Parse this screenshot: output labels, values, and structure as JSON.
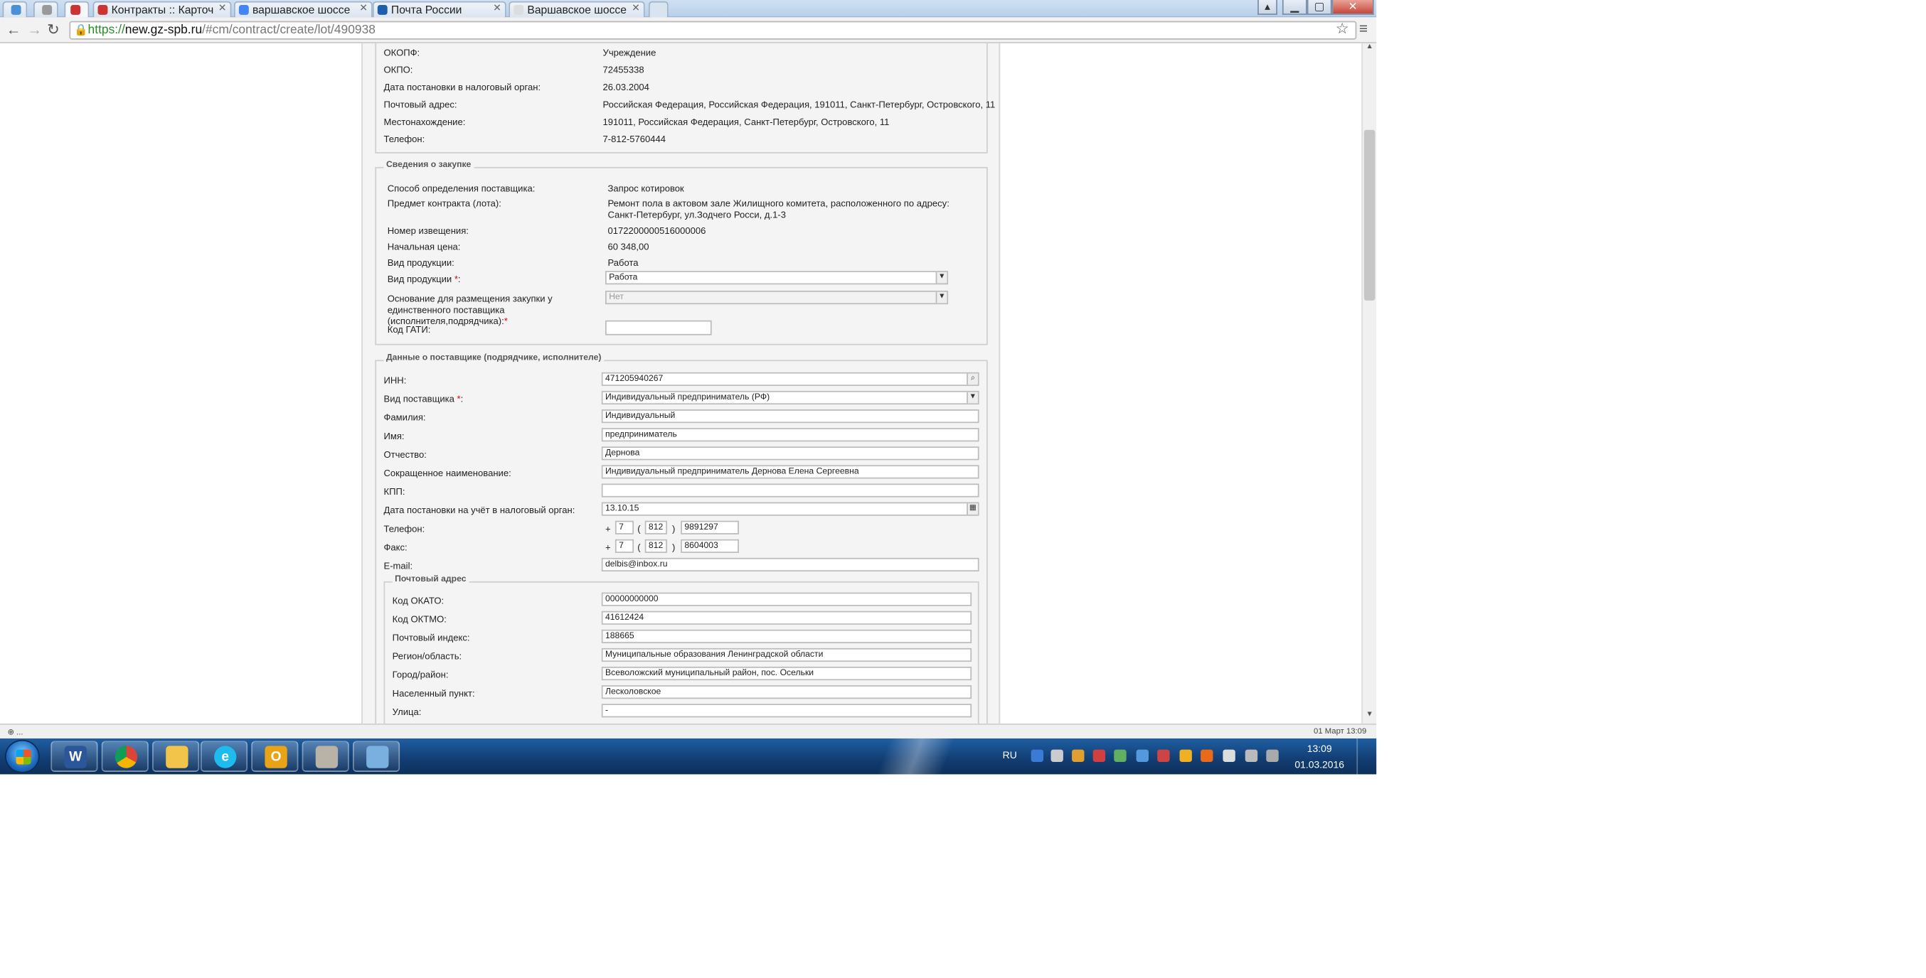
{
  "browser": {
    "tabs": [
      {
        "label": ""
      },
      {
        "label": ""
      },
      {
        "label": "Контракты :: Карточ"
      },
      {
        "label": "варшавское шоссе"
      },
      {
        "label": "Почта России"
      },
      {
        "label": "Варшавское шоссе"
      }
    ],
    "url_scheme": "https://",
    "url_host": "new.gz-spb.ru",
    "url_path": "/#cm/contract/create/lot/490938"
  },
  "customer": {
    "okopf_label": "ОКОПФ:",
    "okopf": "Учреждение",
    "okpo_label": "ОКПО:",
    "okpo": "72455338",
    "tax_date_label": "Дата постановки в налоговый орган:",
    "tax_date": "26.03.2004",
    "postal_label": "Почтовый адрес:",
    "postal": "Российская Федерация, Российская Федерация, 191011, Санкт-Петербург, Островского, 11",
    "location_label": "Местонахождение:",
    "location": "191011, Российская Федерация, Санкт-Петербург, Островского, 11",
    "phone_label": "Телефон:",
    "phone": "7-812-5760444"
  },
  "purchase": {
    "legend": "Сведения о закупке",
    "method_label": "Способ определения поставщика:",
    "method": "Запрос котировок",
    "subject_label": "Предмет контракта (лота):",
    "subject": "Ремонт пола в актовом зале Жилищного комитета, расположенного по адресу: Санкт-Петербург, ул.Зодчего Росси, д.1-3",
    "notice_label": "Номер извещения:",
    "notice": "0172200000516000006",
    "price_label": "Начальная цена:",
    "price": "60 348,00",
    "product_type_label": "Вид продукции:",
    "product_type": "Работа",
    "product_type_select_label": "Вид продукции",
    "product_type_select": "Работа",
    "single_basis_label": "Основание для размещения закупки у единственного поставщика (исполнителя,подрядчика):",
    "single_basis": "Нет",
    "gati_label": "Код ГАТИ:",
    "gati": ""
  },
  "supplier": {
    "legend": "Данные о поставщике (подрядчике, исполнителе)",
    "inn_label": "ИНН:",
    "inn": "471205940267",
    "type_label": "Вид поставщика",
    "type": "Индивидуальный предприниматель (РФ)",
    "last_name_label": "Фамилия:",
    "last_name": "Индивидуальный",
    "first_name_label": "Имя:",
    "first_name": "предприниматель",
    "patronymic_label": "Отчество:",
    "patronymic": "Дернова",
    "short_name_label": "Сокращенное наименование:",
    "short_name": "Индивидуальный предприниматель Дернова Елена Сергеевна",
    "kpp_label": "КПП:",
    "kpp": "",
    "tax_date_label": "Дата постановки на учёт в налоговый орган:",
    "tax_date": "13.10.15",
    "phone_label": "Телефон:",
    "phone_country": "7",
    "phone_code": "812",
    "phone_number": "9891297",
    "fax_label": "Факс:",
    "fax_country": "7",
    "fax_code": "812",
    "fax_number": "8604003",
    "email_label": "E-mail:",
    "email": "delbis@inbox.ru"
  },
  "postal": {
    "legend": "Почтовый адрес",
    "okato_label": "Код ОКАТО:",
    "okato": "00000000000",
    "oktmo_label": "Код ОКТМО:",
    "oktmo": "41612424",
    "index_label": "Почтовый индекс:",
    "index": "188665",
    "region_label": "Регион/область:",
    "region": "Муниципальные образования Ленинградской области",
    "city_label": "Город/район:",
    "city": "Всеволожский муниципальный район, пос. Осельки",
    "settlement_label": "Населенный пункт:",
    "settlement": "Лесколовское",
    "street_label": "Улица:",
    "street": "-"
  },
  "statusbar": {
    "left": "⊕ ...",
    "right": "01 Март 13:09"
  },
  "taskbar": {
    "lang": "RU",
    "time": "13:09",
    "date": "01.03.2016",
    "colors": {
      "word": "#2b579a",
      "chrome": "#db4437",
      "explorer": "#f2c44a",
      "ie": "#1ebbee",
      "outlook": "#e8a416",
      "paint": "#7ab0e0"
    }
  }
}
